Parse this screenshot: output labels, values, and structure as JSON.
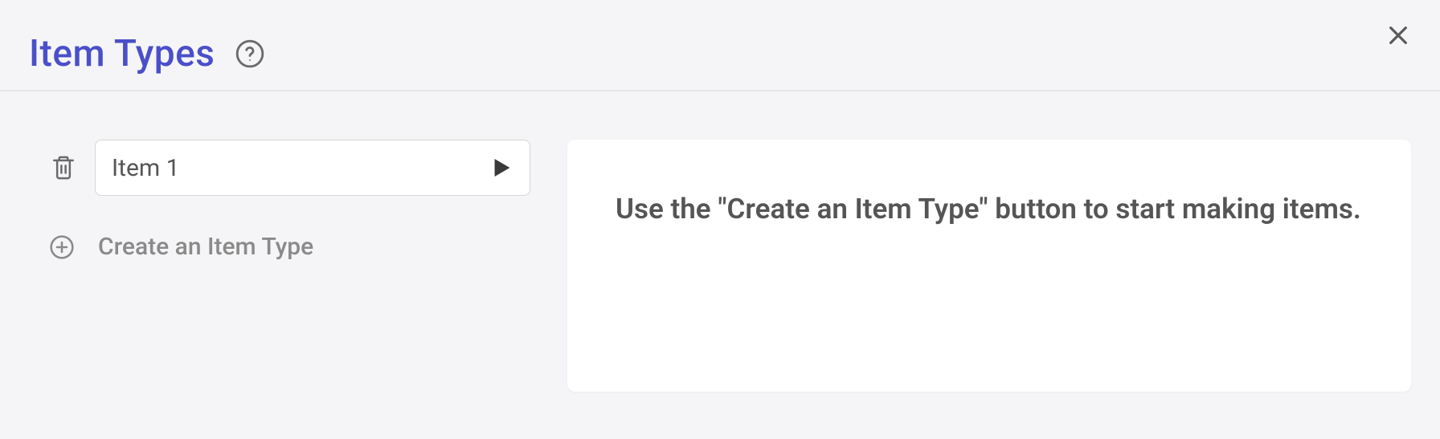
{
  "header": {
    "title": "Item Types"
  },
  "items": [
    {
      "name": "Item 1"
    }
  ],
  "actions": {
    "create_label": "Create an Item Type"
  },
  "panel": {
    "message": "Use the \"Create an Item Type\" button to start making items."
  }
}
